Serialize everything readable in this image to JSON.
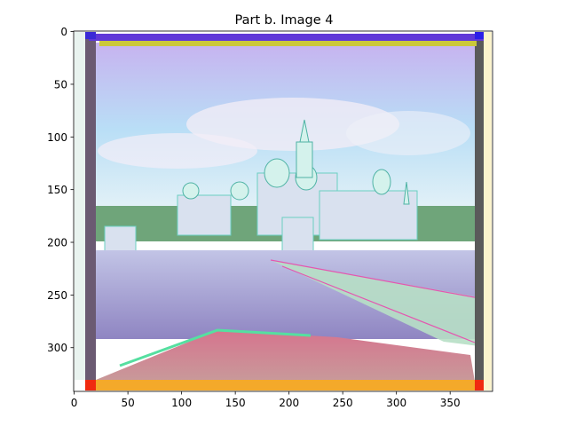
{
  "chart_data": {
    "type": "image",
    "title": "Part b. Image 4",
    "xlabel": "",
    "ylabel": "",
    "xlim": [
      -0.5,
      389.5
    ],
    "ylim": [
      341.5,
      -0.5
    ],
    "y_inverted": true,
    "xticks": [
      0,
      50,
      100,
      150,
      200,
      250,
      300,
      350
    ],
    "yticks": [
      0,
      50,
      100,
      150,
      200,
      250,
      300
    ],
    "grid": false,
    "image_description": "Misaligned RGB color-channel composite photograph of a monastery with domed churches on a lakeside, a long wooden bridge crossing the water to the right, and a foreground bank; colored fringes at the borders"
  }
}
